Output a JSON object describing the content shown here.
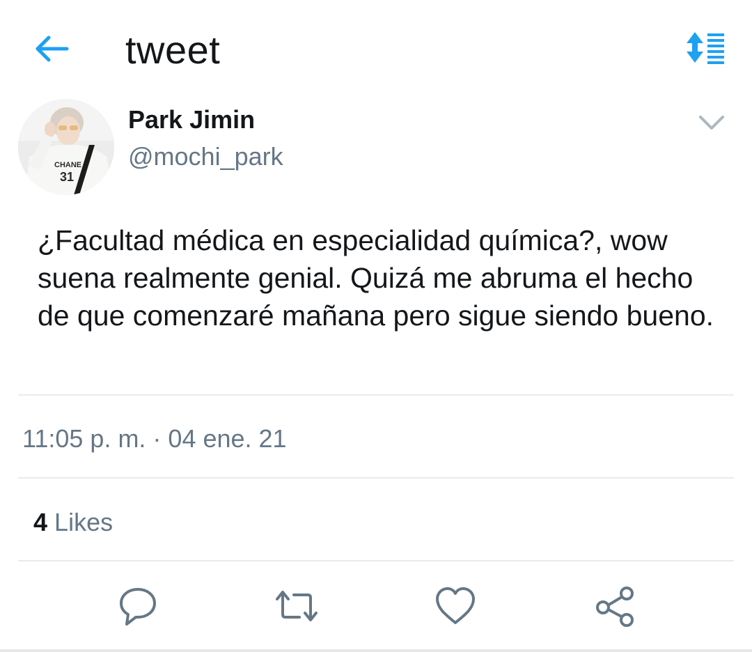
{
  "header": {
    "back_icon": "back-arrow-icon",
    "title": "tweet",
    "sort_icon": "sort-list-icon",
    "accent_color": "#1da1f2"
  },
  "tweet": {
    "avatar_icon": "profile-photo",
    "display_name": "Park Jimin",
    "handle": "@mochi_park",
    "menu_icon": "chevron-down-icon",
    "text": "¿Facultad médica en especialidad química?, wow suena realmente genial. Quizá me abruma el hecho de que comenzaré mañana pero sigue siendo bueno.",
    "timestamp": "11:05 p. m. · 04 ene. 21",
    "likes_count": "4",
    "likes_label": "Likes"
  },
  "actions": [
    {
      "icon": "reply-icon"
    },
    {
      "icon": "retweet-icon"
    },
    {
      "icon": "heart-icon"
    },
    {
      "icon": "share-icon"
    }
  ],
  "colors": {
    "text_primary": "#14171a",
    "text_secondary": "#657786",
    "divider": "#e6ecf0",
    "icon_gray": "#657786"
  }
}
